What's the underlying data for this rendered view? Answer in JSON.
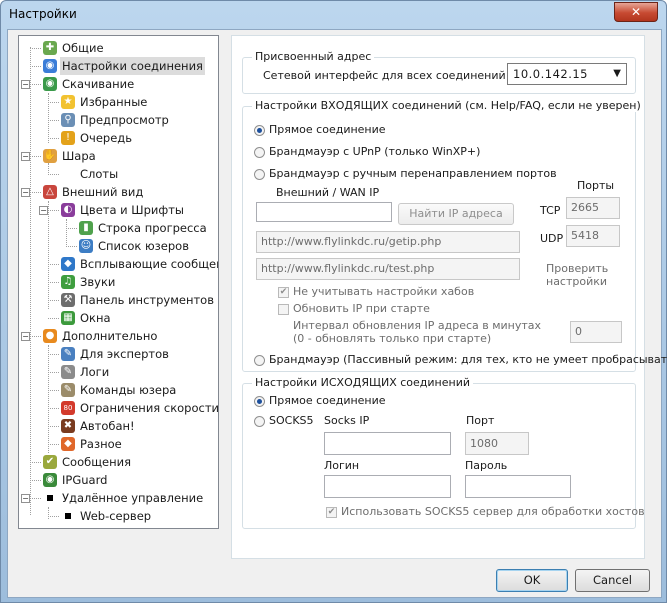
{
  "window": {
    "title": "Настройки",
    "close_glyph": "✕"
  },
  "tree": {
    "items": [
      {
        "label": "Общие",
        "icon": "puzzle-icon",
        "color": "#6aa84f",
        "glyph": "✚"
      },
      {
        "label": "Настройки соединения",
        "icon": "globe-icon",
        "color": "#3b7dd8",
        "glyph": "◉"
      },
      {
        "label": "Скачивание",
        "icon": "globe-download-icon",
        "color": "#3b9a4a",
        "glyph": "◉"
      },
      {
        "label": "Избранные",
        "icon": "star-icon",
        "color": "#f2c230",
        "glyph": "★"
      },
      {
        "label": "Предпросмотр",
        "icon": "magnifier-icon",
        "color": "#6b8fb5",
        "glyph": "⚲"
      },
      {
        "label": "Очередь",
        "icon": "warning-icon",
        "color": "#e3a21a",
        "glyph": "!"
      },
      {
        "label": "Шара",
        "icon": "hand-icon",
        "color": "#e0a040",
        "glyph": "✋"
      },
      {
        "label": "Слоты",
        "icon": "",
        "color": "",
        "glyph": ""
      },
      {
        "label": "Внешний вид",
        "icon": "ruler-icon",
        "color": "#c9463d",
        "glyph": "△"
      },
      {
        "label": "Цвета и Шрифты",
        "icon": "palette-icon",
        "color": "#8a3d9b",
        "glyph": "◐"
      },
      {
        "label": "Строка прогресса",
        "icon": "progress-icon",
        "color": "#4fa14c",
        "glyph": "▮"
      },
      {
        "label": "Список юзеров",
        "icon": "users-icon",
        "color": "#3d7dc4",
        "glyph": "☺"
      },
      {
        "label": "Всплывающие сообщения",
        "icon": "popup-icon",
        "color": "#2f78c9",
        "glyph": "◆"
      },
      {
        "label": "Звуки",
        "icon": "music-icon",
        "color": "#3f9e3f",
        "glyph": "♫"
      },
      {
        "label": "Панель инструментов",
        "icon": "hammer-icon",
        "color": "#6d6d6d",
        "glyph": "⚒"
      },
      {
        "label": "Окна",
        "icon": "windows-icon",
        "color": "#3c9a3c",
        "glyph": "▦"
      },
      {
        "label": "Дополнительно",
        "icon": "orb-icon",
        "color": "#e88a1e",
        "glyph": "●"
      },
      {
        "label": "Для экспертов",
        "icon": "wrench-icon",
        "color": "#4a80c0",
        "glyph": "✎"
      },
      {
        "label": "Логи",
        "icon": "log-icon",
        "color": "#8b8b8b",
        "glyph": "✎"
      },
      {
        "label": "Команды юзера",
        "icon": "pen-icon",
        "color": "#9b8c6a",
        "glyph": "✎"
      },
      {
        "label": "Ограничения скорости",
        "icon": "speed-limit-icon",
        "color": "#d33a2c",
        "glyph": "80"
      },
      {
        "label": "Автобан!",
        "icon": "ban-icon",
        "color": "#7a3b1f",
        "glyph": "✖"
      },
      {
        "label": "Разное",
        "icon": "cube-icon",
        "color": "#e0672a",
        "glyph": "◆"
      },
      {
        "label": "Сообщения",
        "icon": "check-icon",
        "color": "#9aa83d",
        "glyph": "✔"
      },
      {
        "label": "IPGuard",
        "icon": "shield-icon",
        "color": "#3a8a3a",
        "glyph": "◉"
      },
      {
        "label": "Удалённое управление",
        "icon": "square-icon",
        "color": "#000000",
        "glyph": ""
      },
      {
        "label": "Web-сервер",
        "icon": "square-icon",
        "color": "#000000",
        "glyph": ""
      }
    ]
  },
  "assigned": {
    "title": "Присвоенный адрес",
    "label": "Сетевой интерфейс для всех соединений",
    "value": "10.0.142.15"
  },
  "incoming": {
    "title": "Настройки ВХОДЯЩИХ соединений (см. Help/FAQ, если не уверен)",
    "direct": "Прямое соединение",
    "upnp": "Брандмауэр с UPnP (только WinXP+)",
    "manual": "Брандмауэр с ручным перенаправлением портов",
    "wan_label": "Внешний / WAN IP",
    "find_ip": "Найти IP адреса",
    "ports_label": "Порты",
    "tcp_label": "TCP",
    "tcp_value": "2665",
    "udp_label": "UDP",
    "udp_value": "5418",
    "url1": "http://www.flylinkdc.ru/getip.php",
    "url2": "http://www.flylinkdc.ru/test.php",
    "check_line1": "Проверить",
    "check_line2": "настройки",
    "ignore_hubs": "Не учитывать настройки хабов",
    "update_ip": "Обновить IP при старте",
    "interval_line1": "Интервал обновления IP адреса в минутах",
    "interval_line2": "(0 - обновлять только при старте)",
    "interval_value": "0",
    "passive": "Брандмауэр (Пассивный режим: для тех, кто не умеет пробрасывать"
  },
  "outgoing": {
    "title": "Настройки ИСХОДЯЩИХ соединений",
    "direct": "Прямое соединение",
    "socks5": "SOCKS5",
    "socks_ip_label": "Socks IP",
    "port_label": "Порт",
    "port_value": "1080",
    "login_label": "Логин",
    "password_label": "Пароль",
    "use_socks": "Использовать SOCKS5 сервер для обработки хостов"
  },
  "buttons": {
    "ok": "OK",
    "cancel": "Cancel"
  }
}
